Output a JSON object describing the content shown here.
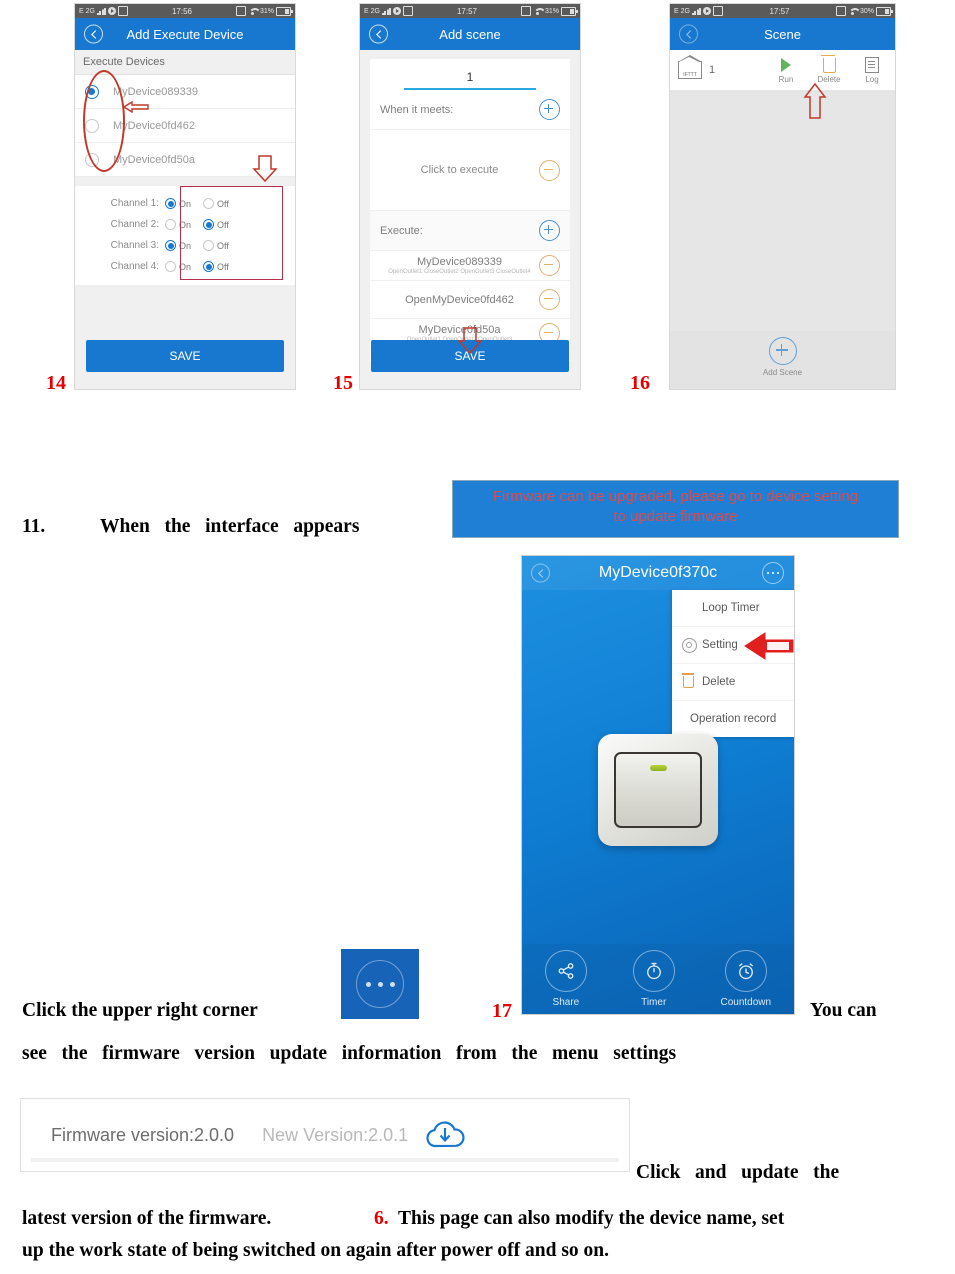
{
  "phone1": {
    "status": {
      "carrier": "E 2G",
      "time": "17:56",
      "battery": "31%"
    },
    "nav_title": "Add Execute Device",
    "section_label": "Execute Devices",
    "devices": [
      {
        "name": "MyDevice089339",
        "selected": true
      },
      {
        "name": "MyDevice0fd462",
        "selected": false
      },
      {
        "name": "MyDevice0fd50a",
        "selected": false
      }
    ],
    "channels": [
      {
        "label": "Channel 1:",
        "on_label": "On",
        "off_label": "Off",
        "state": "On"
      },
      {
        "label": "Channel 2:",
        "on_label": "On",
        "off_label": "Off",
        "state": "Off"
      },
      {
        "label": "Channel 3:",
        "on_label": "On",
        "off_label": "Off",
        "state": "On"
      },
      {
        "label": "Channel 4:",
        "on_label": "On",
        "off_label": "Off",
        "state": "Off"
      }
    ],
    "save_label": "SAVE",
    "step_number": "14"
  },
  "phone2": {
    "status": {
      "carrier": "E 2G",
      "time": "17:57",
      "battery": "31%"
    },
    "nav_title": "Add scene",
    "scene_name": "1",
    "when_label": "When it meets:",
    "click_to_execute": "Click to execute",
    "execute_label": "Execute:",
    "execute_items": [
      {
        "title": "MyDevice089339",
        "detail": "OpenOutlet1 CloseOutlet2 OpenOutlet3 CloseOutlet4"
      },
      {
        "title": "OpenMyDevice0fd462",
        "detail": ""
      },
      {
        "title": "MyDevice0fd50a",
        "detail": "OpenOutlet1 OpenOutlet2 OpenOutlet3"
      }
    ],
    "save_label": "SAVE",
    "step_number": "15"
  },
  "phone3": {
    "status": {
      "carrier": "E 2G",
      "time": "17:57",
      "battery": "30%"
    },
    "nav_title": "Scene",
    "scene_icon_label": "IFTTT",
    "scene_item_name": "1",
    "actions": [
      {
        "label": "Run",
        "icon": "play-icon"
      },
      {
        "label": "Delete",
        "icon": "trash-icon"
      },
      {
        "label": "Log",
        "icon": "log-icon"
      }
    ],
    "add_scene_label": "Add Scene",
    "step_number": "16"
  },
  "firmware_banner": {
    "line1": "Firmware can be upgraded, please go to device setting",
    "line2": "to update firmware"
  },
  "device_panel": {
    "nav_title": "MyDevice0f370c",
    "menu_items": [
      {
        "label": "Loop Timer",
        "icon": ""
      },
      {
        "label": "Setting",
        "icon": "gear-icon"
      },
      {
        "label": "Delete",
        "icon": "trash-icon"
      },
      {
        "label": "Operation record",
        "icon": ""
      }
    ],
    "bottom_actions": [
      {
        "label": "Share",
        "icon": "share-icon"
      },
      {
        "label": "Timer",
        "icon": "stopwatch-icon"
      },
      {
        "label": "Countdown",
        "icon": "alarm-clock-icon"
      }
    ],
    "step_number": "17"
  },
  "firmware_bar": {
    "current": "Firmware version:2.0.0",
    "new": "New Version:2.0.1",
    "download_icon": "cloud-download-icon"
  },
  "body_text": {
    "p11_number": "11.",
    "p11": "When   the   interface   appears",
    "p_click_corner": "Click the upper right corner",
    "p_you_can": "You can",
    "p_see_line": "see   the   firmware   version   update   information   from   the   menu   settings",
    "p_click_update": "Click   and   update   the",
    "p_latest": "latest version of the firmware.",
    "p_six": "6.",
    "p_six_text": "This page can also modify the device name, set",
    "p_last": "up the work state of being switched on again after power off and so on."
  },
  "colors": {
    "accent_blue": "#1878cf",
    "red_annotation": "#e60000",
    "banner_text_red": "#e04a4a"
  }
}
